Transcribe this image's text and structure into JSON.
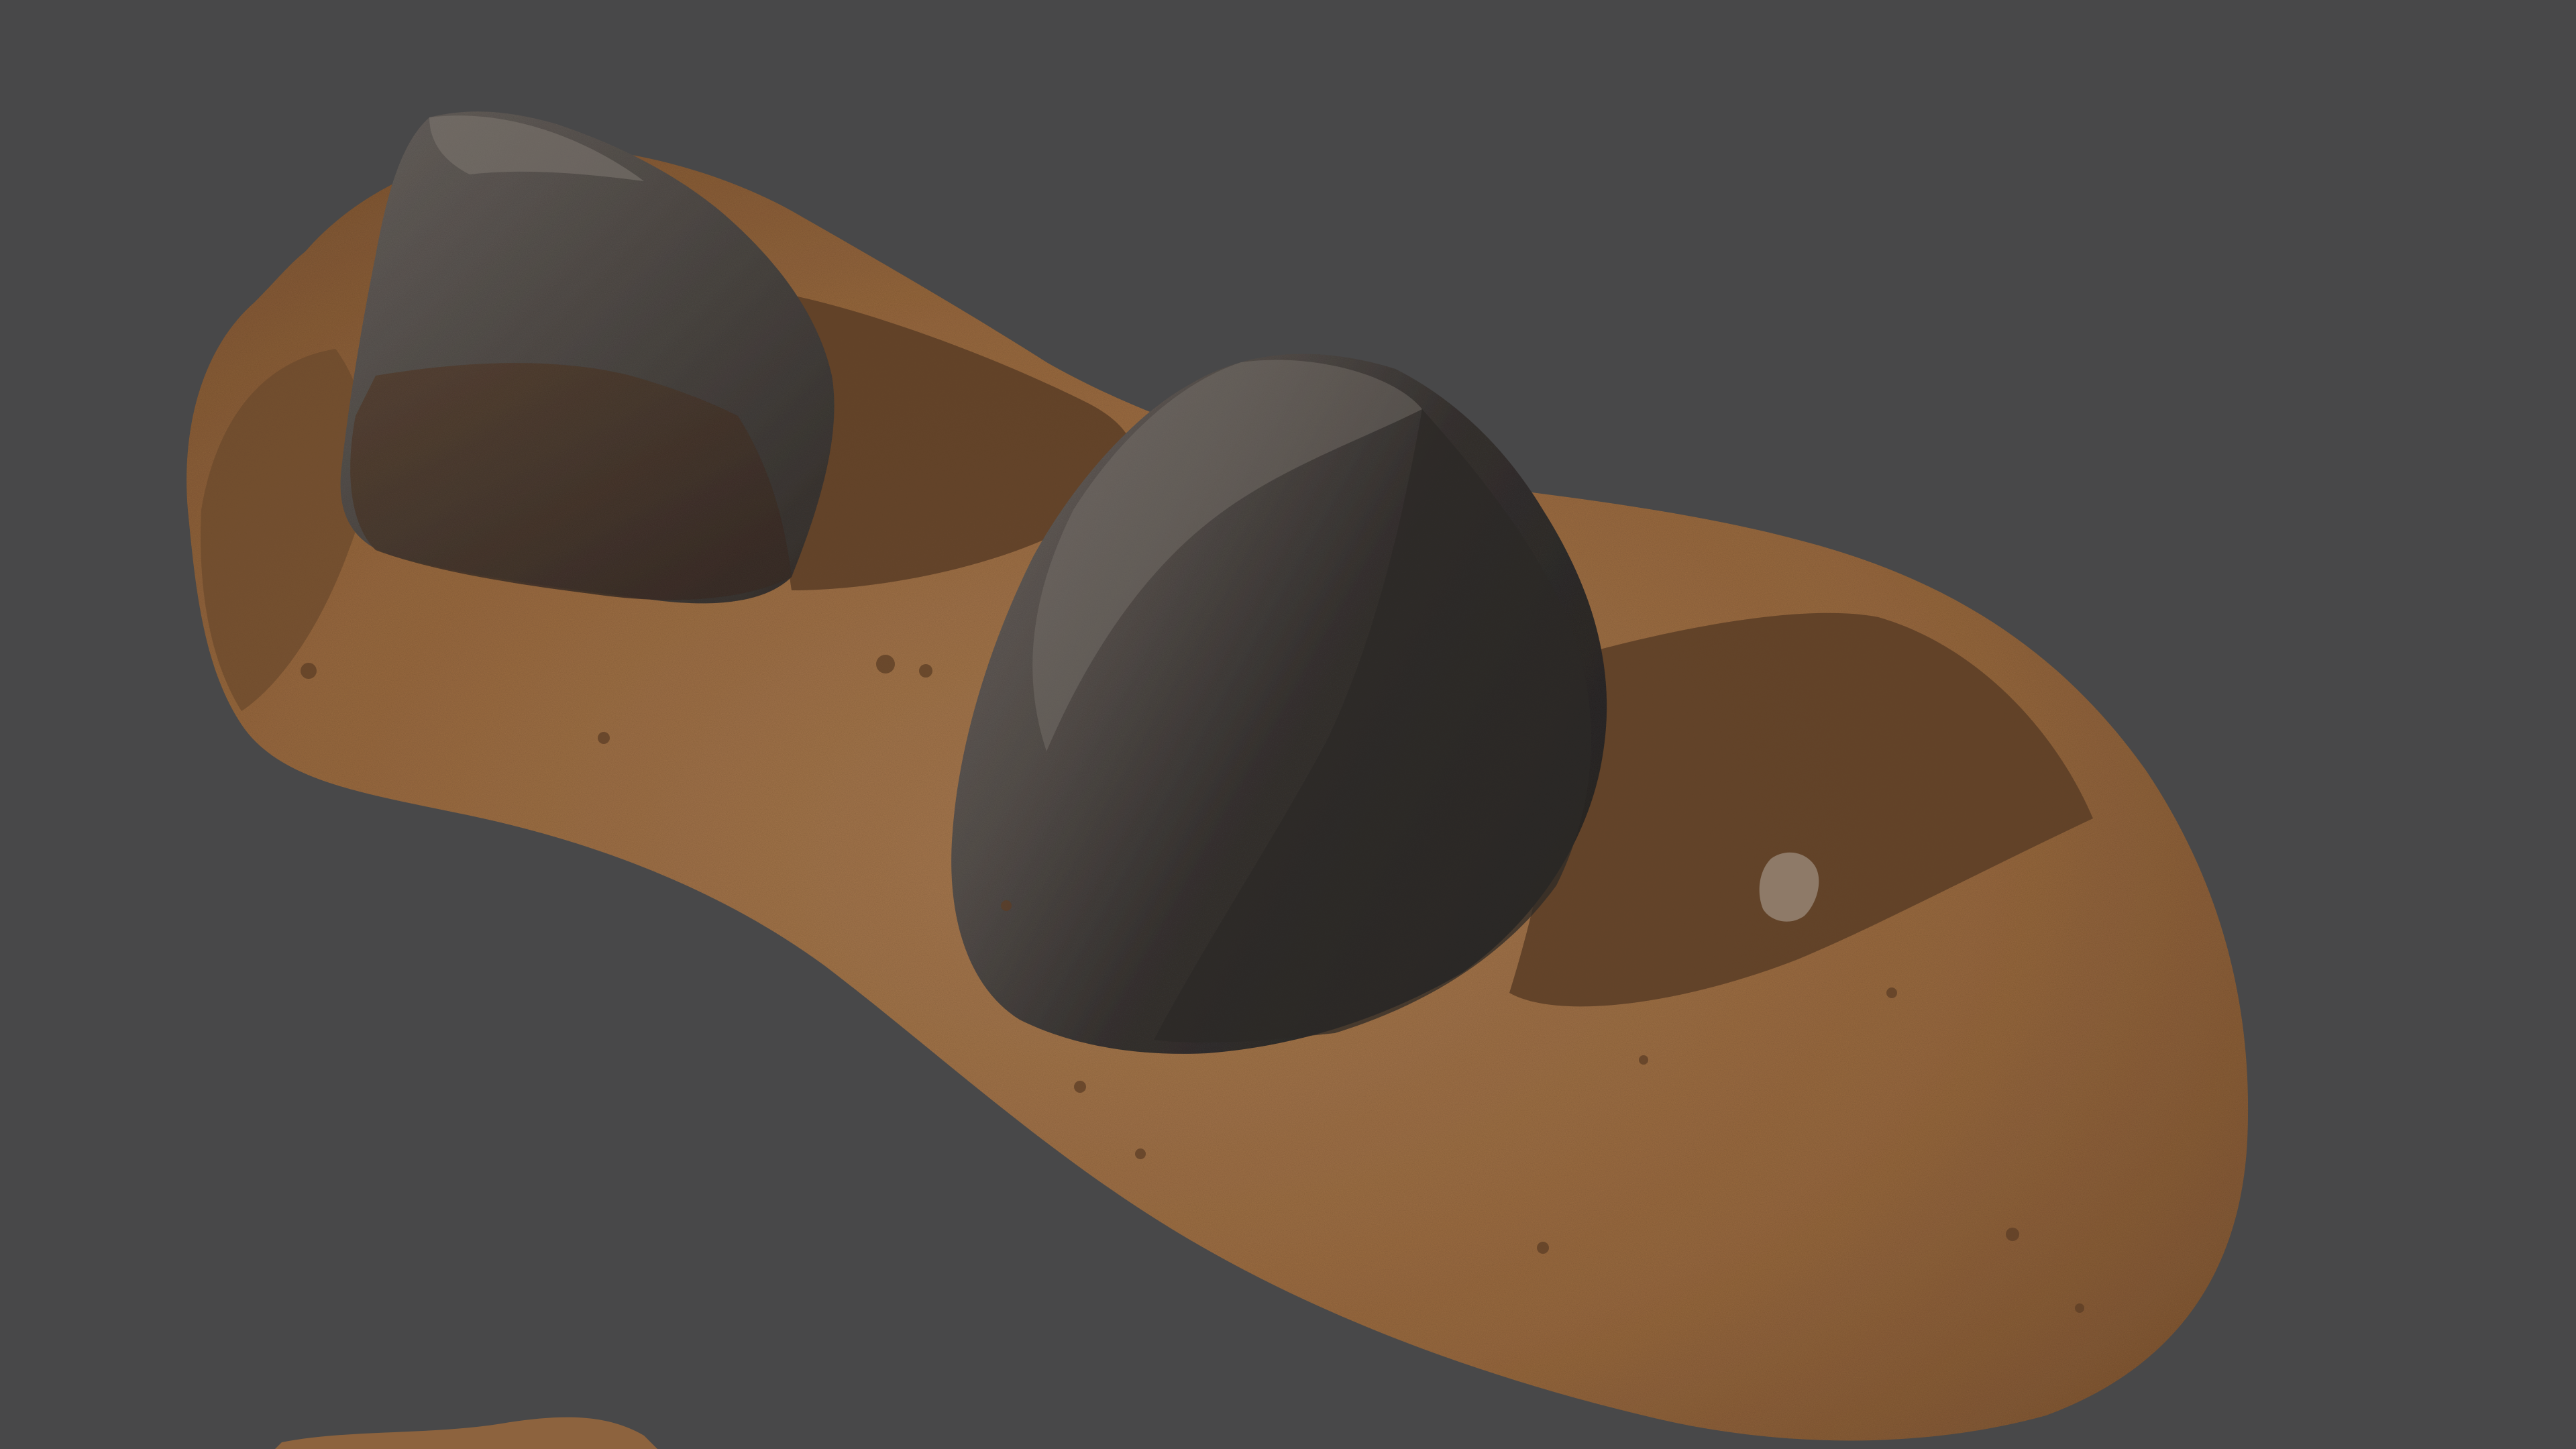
{
  "scene": {
    "background_color": "#484849",
    "ground_color": "#a0714a",
    "ground_shadow_color": "#5d3f27",
    "rock_color": "#4a4643",
    "rock_highlight_color": "#6c6560",
    "rock_shadow_color": "#2e2b29",
    "objects": [
      "sand-ground-patch",
      "left-boulder",
      "center-boulder",
      "small-pebble",
      "bottom-sand-fragment"
    ]
  }
}
